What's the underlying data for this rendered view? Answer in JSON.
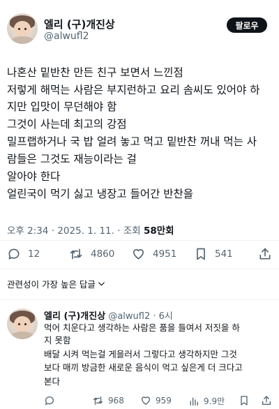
{
  "post": {
    "author_name": "엘리 (구)개진상",
    "author_handle": "@alwufl2",
    "follow_label": "팔로우",
    "lines": [
      "나혼산 밑반찬 만든 친구 보면서 느낀점",
      "저렇게 해먹는 사람은 부지런하고 요리 솜씨도 있어야 하",
      "지만 입맛이 무던해야 함",
      "그것이 사는데 최고의 강점",
      "밀프랩하거나 국 밥 얼려 놓고 먹고 밑반찬 꺼내 먹는 사",
      "람들은 그것도 재능이라는 걸",
      "알아야 한다",
      "얼린국이 먹기 싫고 냉장고 들어간 반찬을"
    ],
    "time": "오후 2:34",
    "date": "2025. 1. 11.",
    "views_label": "조회",
    "views_count": "58만회",
    "stats": {
      "replies": "12",
      "reposts": "4860",
      "likes": "4951",
      "bookmarks": "541"
    }
  },
  "sort": {
    "label": "관련성이 가장 높은 답글"
  },
  "reply": {
    "author_name": "엘리 (구)개진상",
    "author_handle": "@alwufl2",
    "separator": "·",
    "time_ago": "6시",
    "lines": [
      "먹어 치운다고 생각하는 사람은 품을 들여서 저짓을 하",
      "지 못함",
      "배달 시켜 먹는걸 게을러서 그렇다고 생각하지만 그것",
      "보다 매끼 방금한 새로운 음식이 먹고 싶은게 더 크다고",
      "본다"
    ],
    "stats": {
      "reposts": "968",
      "likes": "959",
      "views": "9.9만"
    }
  },
  "colors": {
    "text_primary": "#0f1419",
    "text_secondary": "#536471",
    "divider": "#eff3f4",
    "button_bg": "#0f1419"
  },
  "icons": [
    "reply-icon",
    "repost-icon",
    "like-icon",
    "bookmark-icon",
    "share-icon",
    "views-icon",
    "chevron-down-icon"
  ]
}
